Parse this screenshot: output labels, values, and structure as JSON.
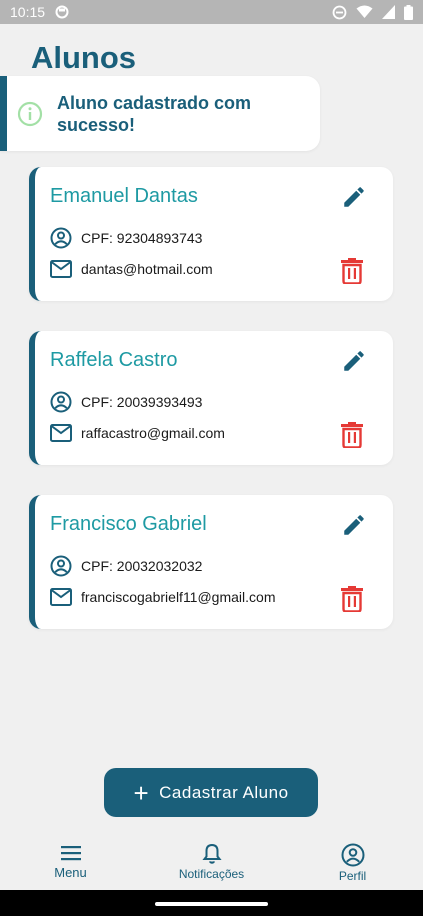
{
  "status_bar": {
    "time": "10:15"
  },
  "header": {
    "title": "Alunos"
  },
  "toast": {
    "message": "Aluno cadastrado com sucesso!",
    "icon": "info-icon"
  },
  "students": [
    {
      "name": "Emanuel Dantas",
      "cpf": "CPF: 92304893743",
      "email": "dantas@hotmail.com"
    },
    {
      "name": "Raffela Castro",
      "cpf": "CPF: 20039393493",
      "email": "raffacastro@gmail.com"
    },
    {
      "name": "Francisco Gabriel",
      "cpf": "CPF: 20032032032",
      "email": "franciscogabrielf11@gmail.com"
    }
  ],
  "fab": {
    "label": "Cadastrar Aluno",
    "icon": "plus-icon"
  },
  "bottom_nav": [
    {
      "label": "Menu",
      "icon": "menu-icon"
    },
    {
      "label": "Notificações",
      "icon": "bell-icon"
    },
    {
      "label": "Perfil",
      "icon": "profile-icon"
    }
  ],
  "colors": {
    "primary": "#1a5f7a",
    "name": "#1e9aa3",
    "delete": "#e53935",
    "info": "#a3e0a6"
  }
}
